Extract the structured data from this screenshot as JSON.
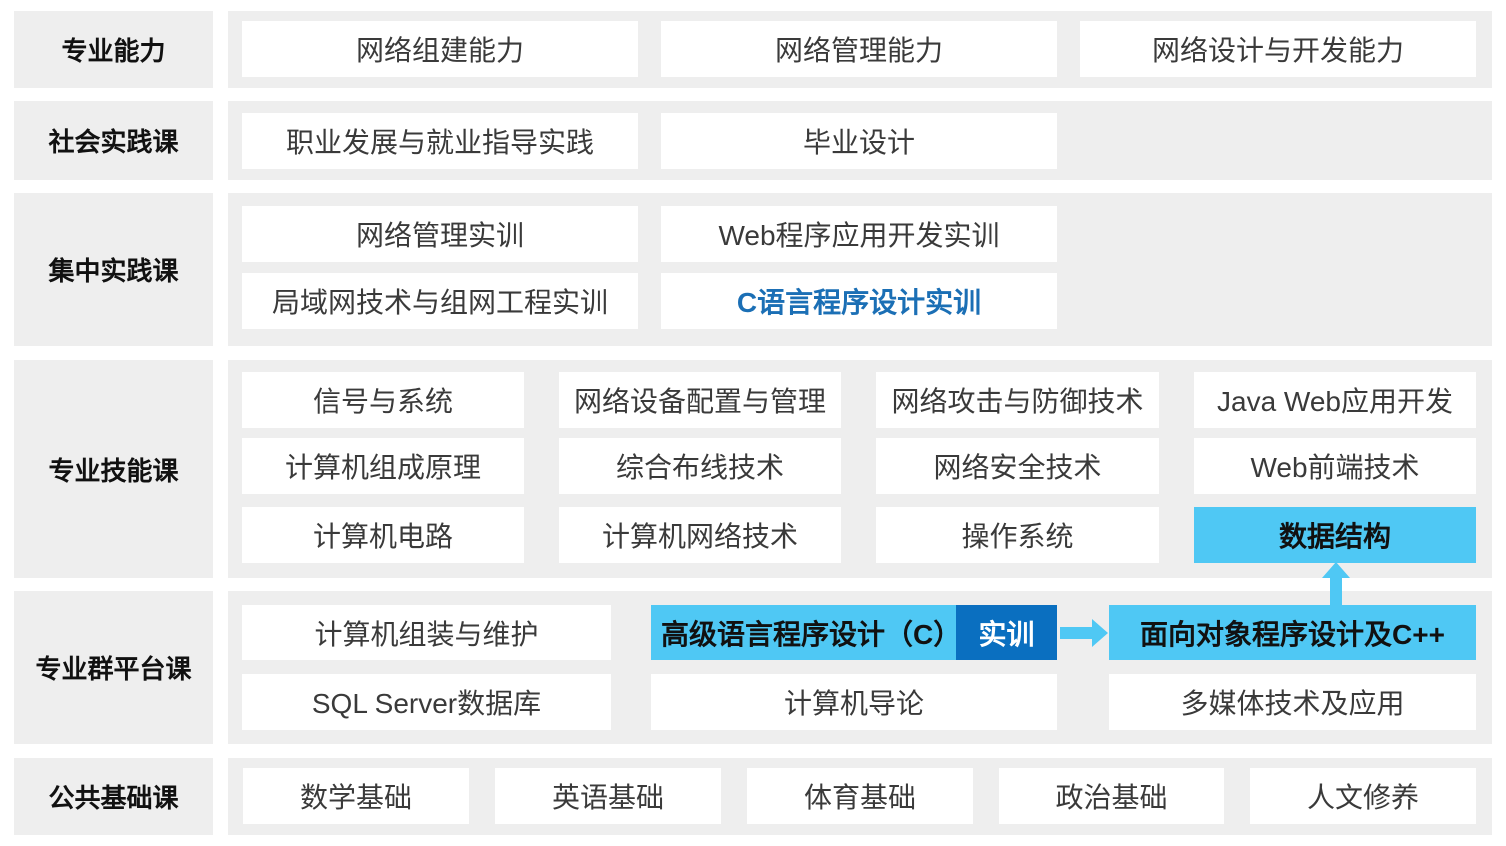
{
  "rows": [
    {
      "key": "professional_ability",
      "label": "专业能力",
      "cells": [
        "网络组建能力",
        "网络管理能力",
        "网络设计与开发能力"
      ]
    },
    {
      "key": "social_practice",
      "label": "社会实践课",
      "cells": [
        "职业发展与就业指导实践",
        "毕业设计"
      ]
    },
    {
      "key": "concentrated_practice",
      "label": "集中实践课",
      "cells": [
        "网络管理实训",
        "Web程序应用开发实训",
        "局域网技术与组网工程实训",
        "C语言程序设计实训"
      ]
    },
    {
      "key": "skill_courses",
      "label": "专业技能课",
      "cells": [
        "信号与系统",
        "网络设备配置与管理",
        "网络攻击与防御技术",
        "Java Web应用开发",
        "计算机组成原理",
        "综合布线技术",
        "网络安全技术",
        "Web前端技术",
        "计算机电路",
        "计算机网络技术",
        "操作系统",
        "数据结构"
      ]
    },
    {
      "key": "platform_courses",
      "label": "专业群平台课",
      "cells": [
        "计算机组装与维护",
        "高级语言程序设计（C）",
        "实训",
        "面向对象程序设计及C++",
        "SQL Server数据库",
        "计算机导论",
        "多媒体技术及应用"
      ]
    },
    {
      "key": "public_basic",
      "label": "公共基础课",
      "cells": [
        "数学基础",
        "英语基础",
        "体育基础",
        "政治基础",
        "人文修养"
      ]
    }
  ],
  "colors": {
    "band_bg": "#eeeeee",
    "cell_bg": "#ffffff",
    "highlight": "#4fc8f4",
    "highlight_dark": "#0a6fc0",
    "accent_text": "#1b6fb5"
  }
}
